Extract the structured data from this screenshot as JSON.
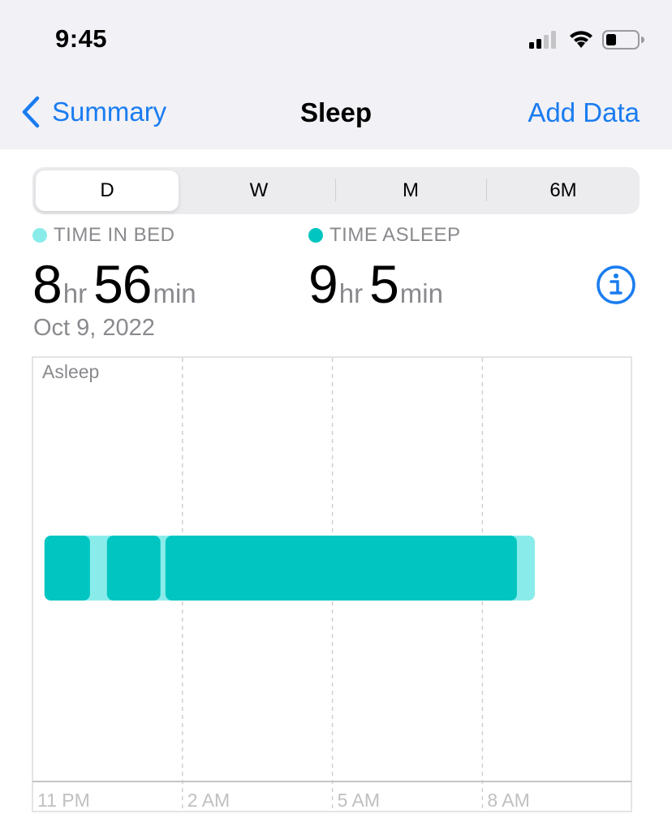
{
  "status_bar": {
    "time": "9:45",
    "icons": [
      "cellular-signal-icon",
      "wifi-icon",
      "battery-icon"
    ]
  },
  "nav": {
    "back_label": "Summary",
    "title": "Sleep",
    "action_label": "Add Data"
  },
  "segmented": {
    "items": [
      "D",
      "W",
      "M",
      "6M"
    ],
    "selected": "D"
  },
  "summary": {
    "time_in_bed": {
      "label": "TIME IN BED",
      "hours": "8",
      "hr_unit": "hr",
      "minutes": "56",
      "min_unit": "min",
      "color": "#8aecea"
    },
    "time_asleep": {
      "label": "TIME ASLEEP",
      "hours": "9",
      "hr_unit": "hr",
      "minutes": "5",
      "min_unit": "min",
      "color": "#00c5c0"
    },
    "date": "Oct 9, 2022"
  },
  "chart_data": {
    "type": "bar",
    "subtype": "timeline",
    "row_label": "Asleep",
    "x_axis": {
      "start": "11 PM",
      "unit": "hours",
      "range_hours": [
        0,
        12
      ],
      "ticks": [
        {
          "label": "11 PM",
          "h": 0
        },
        {
          "label": "2 AM",
          "h": 3
        },
        {
          "label": "5 AM",
          "h": 6
        },
        {
          "label": "8 AM",
          "h": 9
        }
      ]
    },
    "grid": true,
    "series": [
      {
        "name": "In Bed",
        "color": "#8aecea",
        "segments": [
          {
            "start_h": 0.24,
            "end_h": 10.05
          }
        ]
      },
      {
        "name": "Asleep",
        "color": "#00c5c0",
        "segments": [
          {
            "start_h": 0.24,
            "end_h": 1.15
          },
          {
            "start_h": 1.49,
            "end_h": 2.56
          },
          {
            "start_h": 2.66,
            "end_h": 9.69
          }
        ]
      }
    ]
  }
}
